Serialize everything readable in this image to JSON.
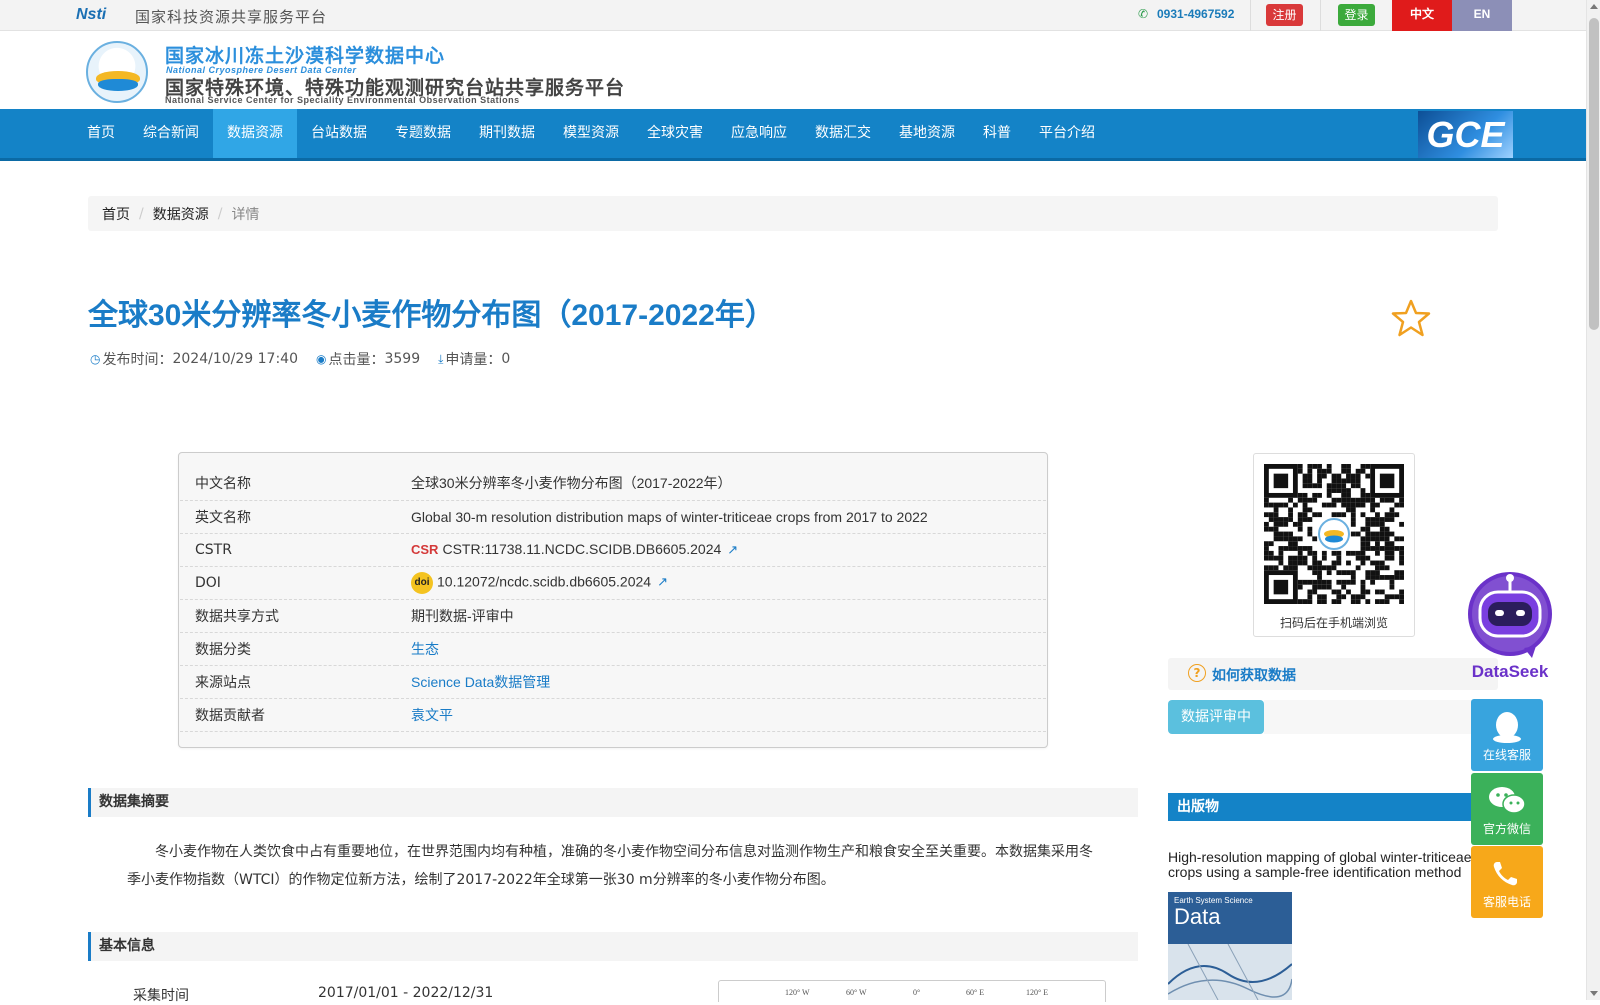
{
  "topbar": {
    "nsti_logo_text": "Nsti",
    "platform_name": "国家科技资源共享服务平台",
    "phone": "0931-4967592",
    "register_label": "注册",
    "login_label": "登录",
    "lang_zh": "中文",
    "lang_en": "EN"
  },
  "header": {
    "title_cn": "国家冰川冻土沙漠科学数据中心",
    "title_en": "National Cryosphere Desert Data Center",
    "subtitle_cn": "国家特殊环境、特殊功能观测研究台站共享服务平台",
    "subtitle_en": "National Service Center for Speciality Environmental Observation Stations"
  },
  "nav": {
    "items": [
      "首页",
      "综合新闻",
      "数据资源",
      "台站数据",
      "专题数据",
      "期刊数据",
      "模型资源",
      "全球灾害",
      "应急响应",
      "数据汇交",
      "基地资源",
      "科普",
      "平台介绍"
    ],
    "active_index": 2,
    "gce_label": "GCE"
  },
  "breadcrumb": {
    "items": [
      "首页",
      "数据资源",
      "详情"
    ]
  },
  "dataset": {
    "title": "全球30米分辨率冬小麦作物分布图（2017-2022年）",
    "publish_label": "发布时间：",
    "publish_time": "2024/10/29 17:40",
    "clicks_label": "点击量：",
    "clicks": "3599",
    "requests_label": "申请量：",
    "requests": "0"
  },
  "info": {
    "rows": [
      {
        "key": "中文名称",
        "value": "全球30米分辨率冬小麦作物分布图（2017-2022年）"
      },
      {
        "key": "英文名称",
        "value": "Global 30-m resolution distribution maps of winter-triticeae crops from 2017 to 2022"
      },
      {
        "key": "CSTR",
        "value": "CSTR:11738.11.NCDC.SCIDB.DB6605.2024"
      },
      {
        "key": "DOI",
        "value": "10.12072/ncdc.scidb.db6605.2024"
      },
      {
        "key": "数据共享方式",
        "value": "期刊数据-评审中"
      },
      {
        "key": "数据分类",
        "value": "生态"
      },
      {
        "key": "来源站点",
        "value": "Science Data数据管理"
      },
      {
        "key": "数据贡献者",
        "value": "袁文平"
      }
    ],
    "cstr_badge": "CSR",
    "doi_badge": "doi"
  },
  "sidebar": {
    "qr_caption": "扫码后在手机端浏览",
    "howto_label": "如何获取数据",
    "review_label": "数据评审中",
    "publications_header": "出版物",
    "publication_title": "High-resolution mapping of global winter-triticeae crops using a sample-free identification method",
    "cover_journal_line1": "Earth System Science",
    "cover_journal_line2": "Data"
  },
  "sections": {
    "abstract_header": "数据集摘要",
    "abstract_text": "冬小麦作物在人类饮食中占有重要地位，在世界范围内均有种植，准确的冬小麦作物空间分布信息对监测作物生产和粮食安全至关重要。本数据集采用冬季小麦作物指数（WTCI）的作物定位新方法，绘制了2017-2022年全球第一张30 m分辨率的冬小麦作物分布图。",
    "basic_header": "基本信息",
    "collect_label": "采集时间",
    "collect_value": "2017/01/01  -  2022/12/31",
    "map_ticks": [
      "120° W",
      "60° W",
      "0°",
      "60° E",
      "120° E"
    ]
  },
  "floating": {
    "dataseek_label": "DataSeek",
    "online_service": "在线客服",
    "wechat": "官方微信",
    "phone_service": "客服电话"
  },
  "colors": {
    "brand_blue": "#1483c7",
    "nav_active": "#30a6e6",
    "title_blue": "#1a7cc7",
    "register_red": "#d9393a",
    "login_green": "#3caa3c",
    "lang_zh_red": "#e01b1b",
    "lang_en_purple": "#8c8fb7"
  }
}
